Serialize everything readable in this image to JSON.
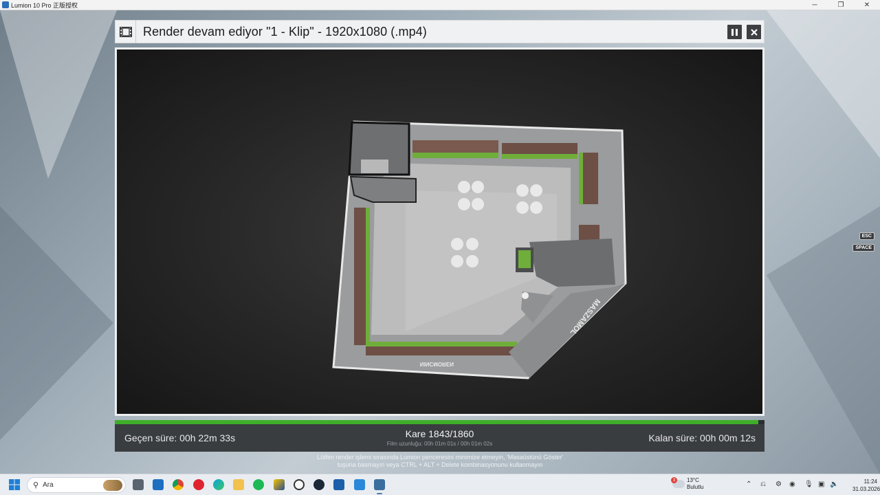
{
  "window": {
    "title": "Lumion 10 Pro 正版授权",
    "controls": [
      "minimize-icon",
      "restore-icon",
      "close-icon"
    ]
  },
  "render": {
    "title": "Render devam ediyor \"1 - Klip\" - 1920x1080 (.mp4)",
    "elapsed": "Geçen süre: 00h 22m 33s",
    "frame": "Kare 1843/1860",
    "film_length": "Film uzunluğu: 00h 01m 01s / 00h 01m 02s",
    "remaining": "Kalan süre: 00h 00m 12s",
    "progress_fraction": 0.9909,
    "progress_color": "#3fae2a",
    "warning_line1": "Lütfen render işlemi sırasında Lumion penceresini minimize etmeyin, 'Masaüstünü Göster'",
    "warning_line2": "tuşuna basmayın veya CTRL + ALT + Delete kombinasyonunu kullanmayın",
    "booth_brand": "MASZAMOL",
    "booth_brand_front": "ИƎЯOMƆИIИ"
  },
  "hints": {
    "esc": "ESC",
    "space": "SPACE"
  },
  "taskbar": {
    "search_placeholder": "Ara",
    "weather_temp": "13°C",
    "weather_desc": "Bulutlu",
    "weather_badge": "3",
    "time": "11:24",
    "date": "31.03.2026"
  }
}
